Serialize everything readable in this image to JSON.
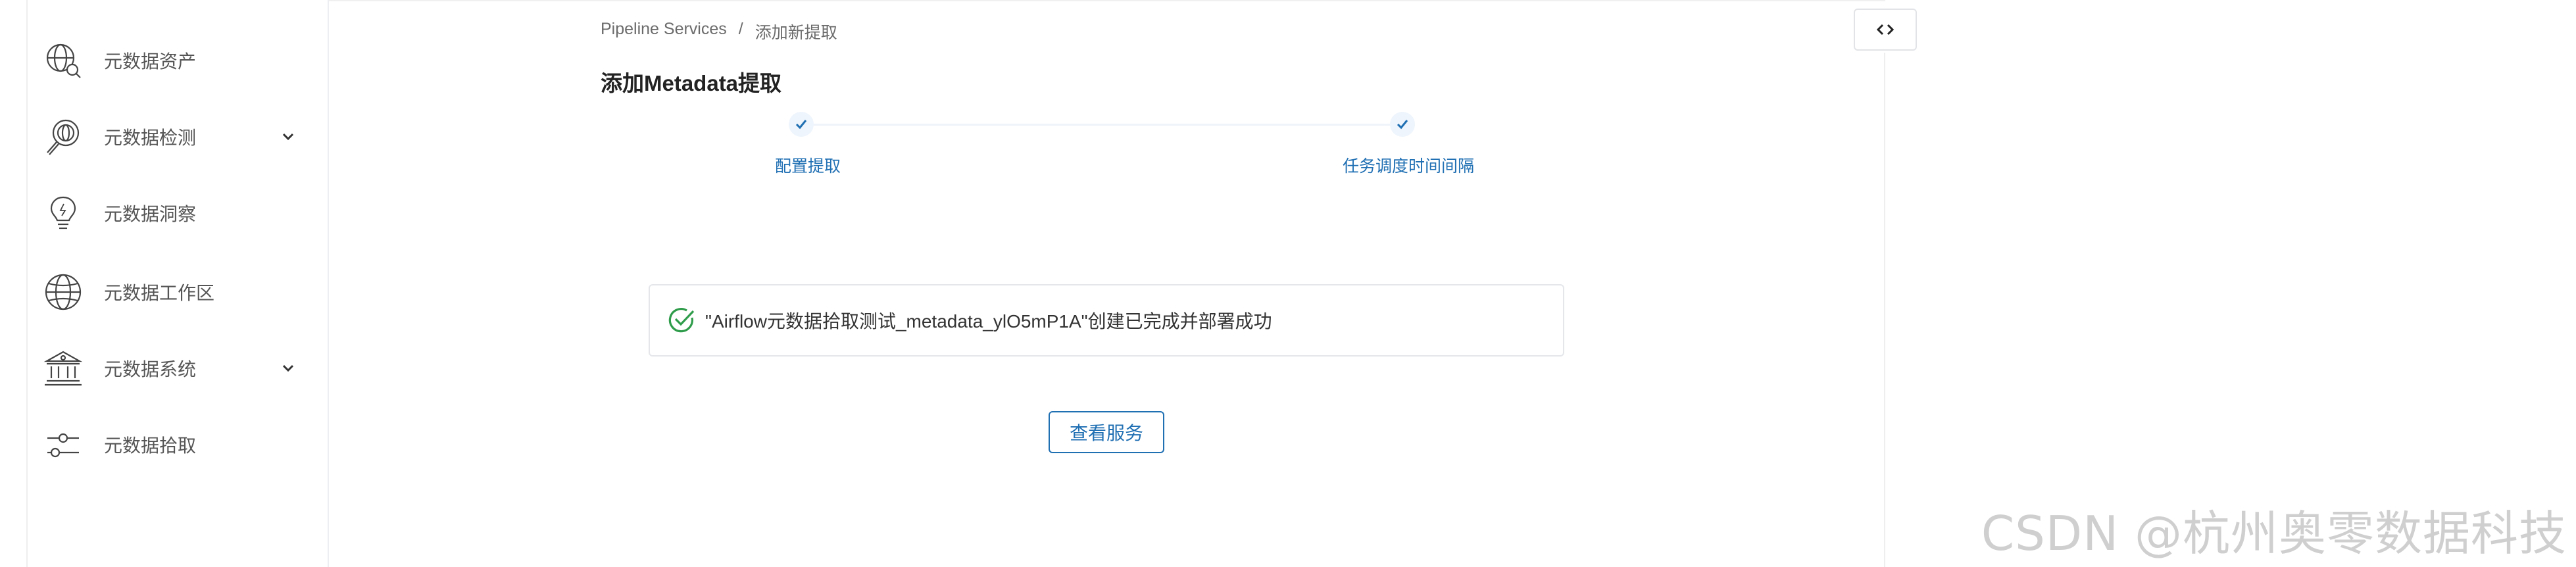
{
  "sidebar": {
    "items": [
      {
        "label": "元数据资产",
        "icon": "globe-search-icon"
      },
      {
        "label": "元数据检测",
        "icon": "magnifier-globe-icon"
      },
      {
        "label": "元数据洞察",
        "icon": "lightbulb-icon"
      },
      {
        "label": "元数据工作区",
        "icon": "globe-icon"
      },
      {
        "label": "元数据系统",
        "icon": "bank-building-icon"
      },
      {
        "label": "元数据拾取",
        "icon": "sliders-icon"
      }
    ]
  },
  "breadcrumb": {
    "root": "Pipeline Services",
    "separator": "/",
    "current": "添加新提取"
  },
  "page_title": "添加Metadata提取",
  "steps": [
    {
      "label": "配置提取",
      "status": "completed"
    },
    {
      "label": "任务调度时间间隔",
      "status": "completed"
    }
  ],
  "success_message": "\"Airflow元数据拾取测试_metadata_ylO5mP1A\"创建已完成并部署成功",
  "view_service_button": "查看服务",
  "watermark": "CSDN @杭州奥零数据科技",
  "colors": {
    "accent": "#1f6fb3",
    "success": "#2e9c4a",
    "text": "#333333"
  }
}
